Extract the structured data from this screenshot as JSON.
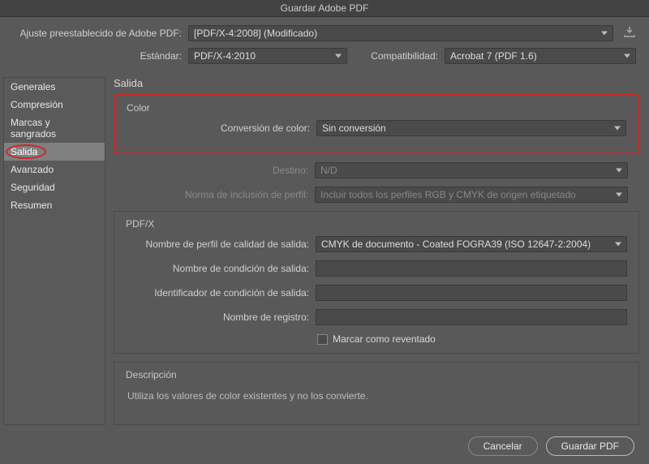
{
  "title": "Guardar Adobe PDF",
  "top": {
    "preset_label": "Ajuste preestablecido de Adobe PDF:",
    "preset_value": "[PDF/X-4:2008] (Modificado)",
    "standard_label": "Estándar:",
    "standard_value": "PDF/X-4:2010",
    "compat_label": "Compatibilidad:",
    "compat_value": "Acrobat 7 (PDF 1.6)"
  },
  "sidebar": {
    "items": [
      {
        "label": "Generales"
      },
      {
        "label": "Compresión"
      },
      {
        "label": "Marcas y sangrados"
      },
      {
        "label": "Salida"
      },
      {
        "label": "Avanzado"
      },
      {
        "label": "Seguridad"
      },
      {
        "label": "Resumen"
      }
    ]
  },
  "panel": {
    "title": "Salida",
    "color": {
      "legend": "Color",
      "conversion_label": "Conversión de color:",
      "conversion_value": "Sin conversión",
      "destination_label": "Destino:",
      "destination_value": "N/D",
      "profile_inclusion_label": "Norma de inclusión de perfil:",
      "profile_inclusion_value": "Incluir todos los perfiles RGB y CMYK de origen etiquetado"
    },
    "pdfx": {
      "legend": "PDF/X",
      "quality_profile_label": "Nombre de perfil de calidad de salida:",
      "quality_profile_value": "CMYK de documento - Coated FOGRA39 (ISO 12647-2:2004)",
      "out_cond_name_label": "Nombre de condición de salida:",
      "out_cond_name_value": "",
      "out_cond_id_label": "Identificador de condición de salida:",
      "out_cond_id_value": "",
      "registry_label": "Nombre de registro:",
      "registry_value": "",
      "trapped_label": "Marcar como reventado"
    },
    "description": {
      "legend": "Descripción",
      "text": "Utiliza los valores de color existentes y no los convierte."
    }
  },
  "footer": {
    "cancel": "Cancelar",
    "save": "Guardar PDF"
  }
}
